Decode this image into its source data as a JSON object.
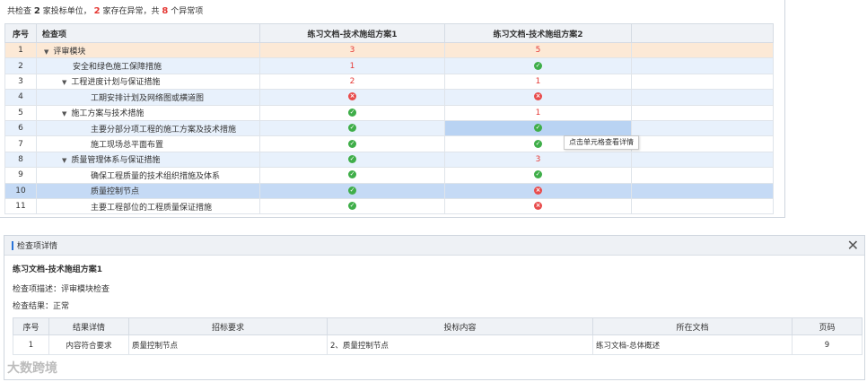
{
  "summary": {
    "p1": "共检查",
    "count_units": "2",
    "p2": "家投标单位，",
    "count_abnormal_units": "2",
    "p3": "家存在异常，共",
    "count_items": "8",
    "p4": "个异常项"
  },
  "grid": {
    "headers": [
      "序号",
      "检查项",
      "练习文档-技术施组方案1",
      "练习文档-技术施组方案2",
      ""
    ],
    "rows": [
      {
        "idx": "1",
        "label": "评审模块",
        "level": 0,
        "expanded": true,
        "v1": "3",
        "v2": "5"
      },
      {
        "idx": "2",
        "label": "安全和绿色施工保障措施",
        "level": 1,
        "v1": "1",
        "v2": "ok"
      },
      {
        "idx": "3",
        "label": "工程进度计划与保证措施",
        "level": 1,
        "expanded": true,
        "v1": "2",
        "v2": "1"
      },
      {
        "idx": "4",
        "label": "工期安排计划及网络图或横道图",
        "level": 2,
        "v1": "bad",
        "v2": "bad"
      },
      {
        "idx": "5",
        "label": "施工方案与技术措施",
        "level": 1,
        "expanded": true,
        "v1": "ok",
        "v2": "1"
      },
      {
        "idx": "6",
        "label": "主要分部分项工程的施工方案及技术措施",
        "level": 2,
        "v1": "ok",
        "v2": "ok"
      },
      {
        "idx": "7",
        "label": "施工现场总平面布置",
        "level": 2,
        "v1": "ok",
        "v2": "ok"
      },
      {
        "idx": "8",
        "label": "质量管理体系与保证措施",
        "level": 1,
        "expanded": true,
        "v1": "ok",
        "v2": "3"
      },
      {
        "idx": "9",
        "label": "确保工程质量的技术组织措施及体系",
        "level": 2,
        "v1": "ok",
        "v2": "ok"
      },
      {
        "idx": "10",
        "label": "质量控制节点",
        "level": 2,
        "v1": "ok",
        "v2": "bad"
      },
      {
        "idx": "11",
        "label": "主要工程部位的工程质量保证措施",
        "level": 2,
        "v1": "ok",
        "v2": "bad"
      }
    ]
  },
  "tooltip": "点击单元格查看详情",
  "panel": {
    "title": "检查项详情",
    "doc_name": "练习文档-技术施组方案1",
    "desc_label": "检查项描述：",
    "desc_value": "评审模块检查",
    "result_label": "检查结果：",
    "result_value": "正常",
    "table": {
      "headers": [
        "序号",
        "结果详情",
        "招标要求",
        "投标内容",
        "所在文档",
        "页码"
      ],
      "rows": [
        {
          "no": "1",
          "detail": "内容符合要求",
          "req": "质量控制节点",
          "bid": "2、质量控制节点",
          "doc": "练习文档-总体概述",
          "page": "9"
        }
      ]
    }
  },
  "watermark": "大数跨境",
  "colors": {
    "accent": "#2a74d9",
    "error": "#e53935",
    "ok": "#3fae49",
    "selected_row": "#c5daf5",
    "top_row": "#fce9d6"
  }
}
